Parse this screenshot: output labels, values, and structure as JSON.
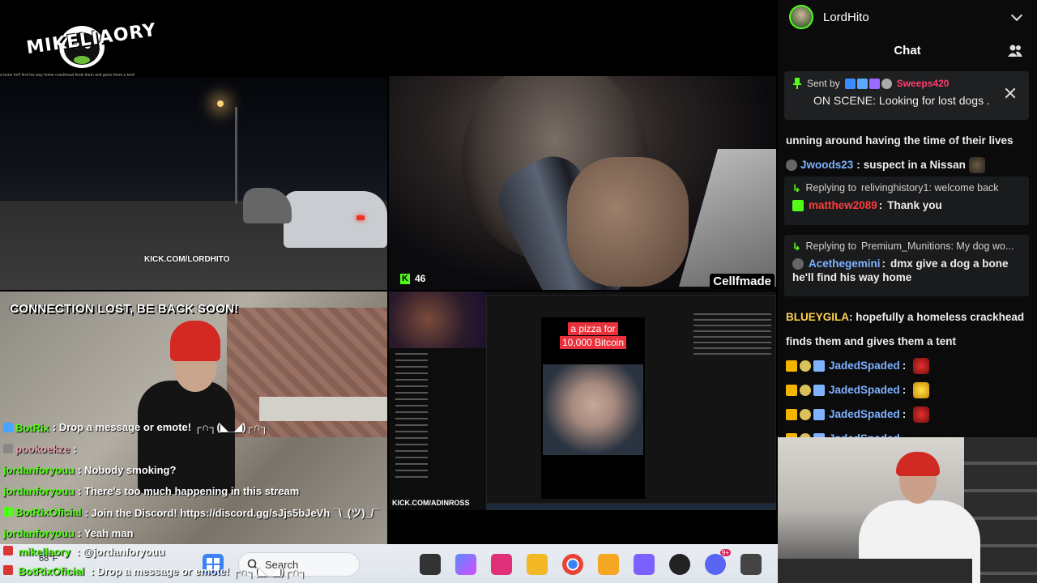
{
  "logo": {
    "text": "MIKELIAORY"
  },
  "ticker_text": "a bone he'll find his way home   crackhead finds them and gives them a tent!",
  "car_tile": {
    "kick_tag": "KICK.COM/LORDHITO"
  },
  "drink_tile": {
    "viewer_count": "46",
    "handle": "Cellfmade"
  },
  "street_tile": {
    "banner": "CONNECTION LOST, BE BACK SOON!"
  },
  "screen_tile": {
    "caption_line1": "a pizza for",
    "caption_line2": "10,000 Bitcoin",
    "kick_tag": "KICK.COM/ADINROSS"
  },
  "overlay_chat": [
    {
      "user": "BotRix",
      "text": ": Drop a message or emote! ┌∩┐(◣_◢)┌∩┐",
      "user_color": "#53fc18",
      "badge_color": "#4aa3ff"
    },
    {
      "user": "pookoekze",
      "text": ":",
      "user_color": "#e3a0b0",
      "badge_color": "#888888"
    },
    {
      "user": "jordanforyouu",
      "text": ": Nobody smoking?",
      "user_color": "#53fc18",
      "badge_color": ""
    },
    {
      "user": "jordanforyouu",
      "text": ": There's too much happening in this stream",
      "user_color": "#53fc18",
      "badge_color": ""
    },
    {
      "user": "BotRixOficial",
      "text": ": Join the Discord! https://discord.gg/sJjs5bJeVh ¯\\_(ツ)_/¯",
      "user_color": "#53fc18",
      "badge_color": "#53fc18"
    },
    {
      "user": "jordanforyouu",
      "text": ": Yeah man",
      "user_color": "#53fc18",
      "badge_color": ""
    },
    {
      "user": "mikeliaory",
      "text": ": @jordanforyouu",
      "user_color": "#53fc18",
      "badge_color": "#d93636"
    }
  ],
  "overlay_bottom": {
    "user": "BotRixOficial",
    "text": ": Drop a message or emote! ┌∩┐(◣_◢)┌∩┐"
  },
  "taskbar": {
    "weather": "68°F",
    "search_label": "Search",
    "notification_count": "9+"
  },
  "chat": {
    "streamer_name": "LordHito",
    "title": "Chat",
    "pinned": {
      "sent_by_label": "Sent by",
      "sender": "Sweeps420",
      "message": "ON SCENE: Looking for lost dogs ."
    },
    "messages": {
      "m1": "unning around having the time of their lives",
      "m2_user": "Jwoods23",
      "m2_text": "suspect in a Nissan",
      "r1_label": "Replying to",
      "r1_target": "relivinghistory1: welcome back",
      "r1_user": "matthew2089",
      "r1_text": "Thank you",
      "r2_label": "Replying to",
      "r2_target": "Premium_Munitions: My dog wo...",
      "r2_user": "Acethegemini",
      "r2_text": "dmx give a dog a bone",
      "r2_text2": "he'll find his way home",
      "m3_user": "BLUEYGILA",
      "m3_text": "hopefully a homeless crackhead",
      "m3_text2": "finds them and gives them a tent",
      "j_user": "JadedSpaded",
      "j_colon": ":"
    },
    "colors": {
      "accent": "#53fc18",
      "pinned_user": "#ff3d6e",
      "user_blue": "#7fb2ff",
      "user_red": "#ff3b3b",
      "user_yellow": "#ffd34d"
    }
  }
}
